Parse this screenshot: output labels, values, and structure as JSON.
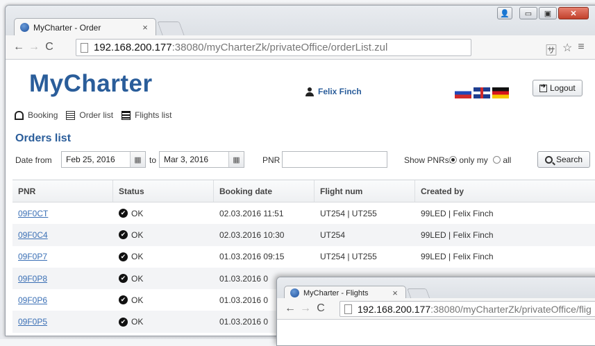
{
  "browser": {
    "tab_title": "MyCharter - Order",
    "tab_close": "×",
    "url_host": "192.168.200.177",
    "url_path": ":38080/myCharterZk/privateOffice/orderList.zul",
    "controls": {
      "user": "👤",
      "minimize": "▭",
      "maximize": "▣",
      "close": "✕"
    }
  },
  "app": {
    "logo": "MyCharter",
    "user_name": "Felix Finch",
    "logout_label": "Logout",
    "flags": [
      "ru",
      "uk",
      "de"
    ]
  },
  "menu": {
    "items": [
      {
        "label": "Booking",
        "icon": "home-icon"
      },
      {
        "label": "Order list",
        "icon": "list-icon"
      },
      {
        "label": "Flights list",
        "icon": "flights-icon"
      }
    ]
  },
  "orders": {
    "title": "Orders list",
    "filters": {
      "date_from_label": "Date from",
      "date_from_value": "Feb 25, 2016",
      "to_label": "to",
      "date_to_value": "Mar 3, 2016",
      "pnr_label": "PNR",
      "pnr_value": "",
      "show_pnrs_label": "Show PNRs:",
      "only_my_label": "only my",
      "all_label": "all",
      "selected": "only_my",
      "search_label": "Search"
    },
    "columns": [
      "PNR",
      "Status",
      "Booking date",
      "Flight num",
      "Created by"
    ],
    "rows": [
      {
        "pnr": "09F0CT",
        "status": "OK",
        "booking_date": "02.03.2016 11:51",
        "flight": "UT254 | UT255",
        "created_by": "99LED | Felix Finch"
      },
      {
        "pnr": "09F0C4",
        "status": "OK",
        "booking_date": "02.03.2016 10:30",
        "flight": "UT254",
        "created_by": "99LED | Felix Finch"
      },
      {
        "pnr": "09F0P7",
        "status": "OK",
        "booking_date": "01.03.2016 09:15",
        "flight": "UT254 | UT255",
        "created_by": "99LED | Felix Finch"
      },
      {
        "pnr": "09F0P8",
        "status": "OK",
        "booking_date": "01.03.2016 0",
        "flight": "",
        "created_by": ""
      },
      {
        "pnr": "09F0P6",
        "status": "OK",
        "booking_date": "01.03.2016 0",
        "flight": "",
        "created_by": ""
      },
      {
        "pnr": "09F0P5",
        "status": "OK",
        "booking_date": "01.03.2016 0",
        "flight": "",
        "created_by": ""
      }
    ]
  },
  "second_window": {
    "tab_title": "MyCharter - Flights",
    "tab_close": "×",
    "url_host": "192.168.200.177",
    "url_path": ":38080/myCharterZk/privateOffice/flig"
  }
}
